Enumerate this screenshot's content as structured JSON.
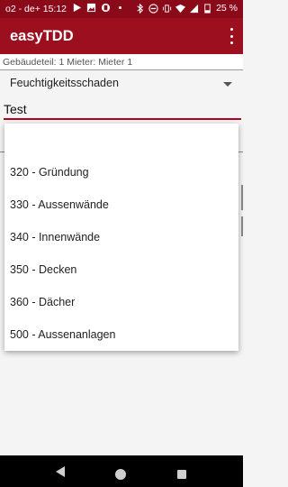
{
  "status_bar": {
    "carrier": "o2 - de+",
    "time": "15:12",
    "battery": "25 %",
    "left_icons": [
      "play-icon",
      "image-icon",
      "app-icon",
      "dot-icon"
    ],
    "right_icons": [
      "bluetooth-icon",
      "dnd-icon",
      "vibrate-icon",
      "wifi-icon",
      "signal-icon",
      "battery-icon"
    ]
  },
  "app_bar": {
    "title": "easyTDD",
    "colors": {
      "status": "#8b0a1a",
      "app": "#9b0f1f",
      "accent": "#b3001e"
    }
  },
  "subheader": {
    "text": "Gebäudeteil: 1 Mieter: Mieter 1"
  },
  "spinner": {
    "selected": "Feuchtigkeitsschaden"
  },
  "text_field": {
    "value": "Test"
  },
  "dropdown": {
    "items": [
      {
        "label": ""
      },
      {
        "label": "320 - Gründung"
      },
      {
        "label": "330 - Aussenwände"
      },
      {
        "label": "340 - Innenwände"
      },
      {
        "label": "350 - Decken"
      },
      {
        "label": "360 - Dächer"
      },
      {
        "label": "500 - Aussenanlagen"
      }
    ]
  },
  "nav_bar": {
    "icons": [
      "back-icon",
      "home-icon",
      "recents-icon"
    ]
  }
}
